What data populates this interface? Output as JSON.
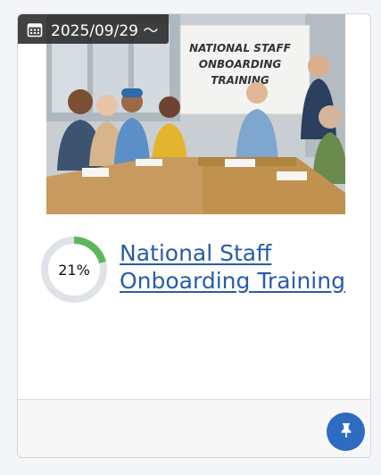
{
  "card": {
    "date_badge": {
      "icon": "calendar-icon",
      "text": "2025/09/29 〜"
    },
    "image": {
      "whiteboard_text": [
        "NATIONAL STAFF",
        "ONBOARDING",
        "TRAINING"
      ]
    },
    "progress": {
      "value": 0.21,
      "label": "21%",
      "color": "#5cb85c",
      "track_color": "#dfe2e6"
    },
    "title": "National Staff Onboarding Training",
    "footer": {
      "pin_button": {
        "icon": "pin-icon",
        "color": "#2d6cc0"
      }
    }
  }
}
